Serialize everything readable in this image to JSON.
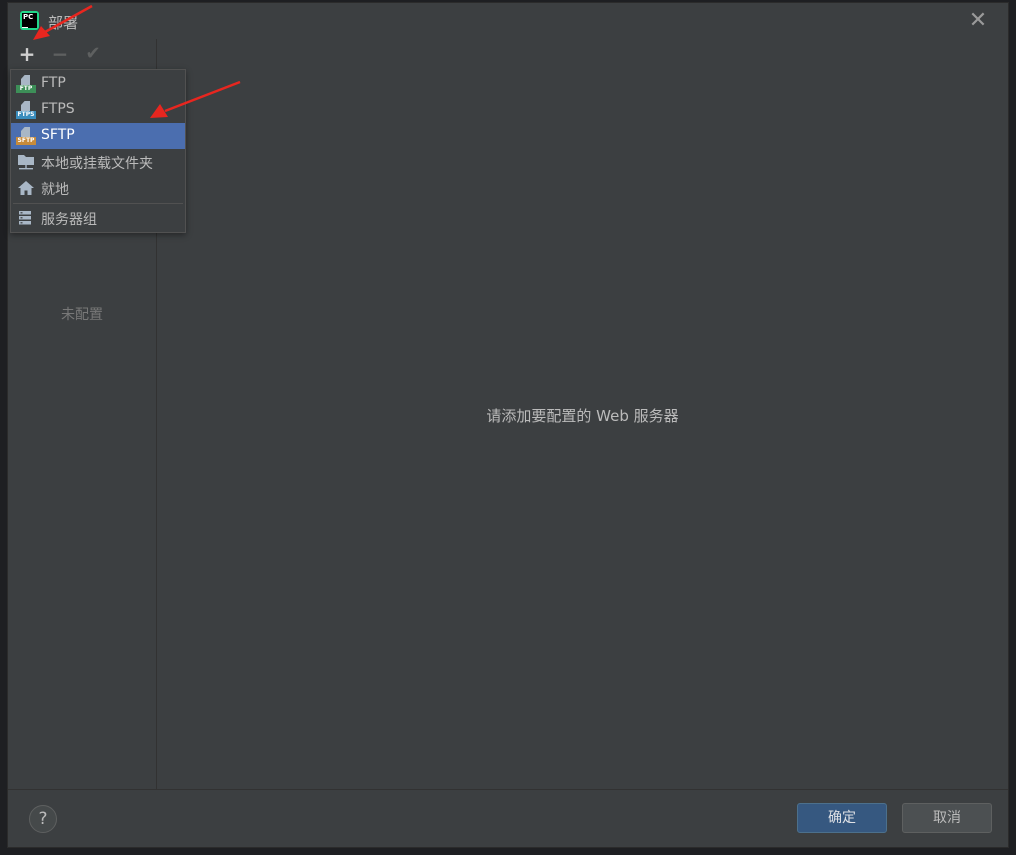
{
  "window": {
    "title": "部署",
    "app_icon_text": "PC"
  },
  "toolbar": {
    "add": "+",
    "remove": "−",
    "apply": "✔"
  },
  "sidebar": {
    "empty_text": "未配置"
  },
  "main": {
    "message": "请添加要配置的 Web 服务器"
  },
  "menu": {
    "items": [
      {
        "label": "FTP",
        "icon": "ftp-icon",
        "badge": "FTP",
        "badge_color": "#3d8f58",
        "selected": false
      },
      {
        "label": "FTPS",
        "icon": "ftps-icon",
        "badge": "FTPS",
        "badge_color": "#3a8dbd",
        "selected": false
      },
      {
        "label": "SFTP",
        "icon": "sftp-icon",
        "badge": "SFTP",
        "badge_color": "#c78b3a",
        "selected": true
      },
      {
        "label": "本地或挂载文件夹",
        "icon": "network-folder-icon",
        "selected": false
      },
      {
        "label": "就地",
        "icon": "home-icon",
        "selected": false
      }
    ],
    "group_item": {
      "label": "服务器组",
      "icon": "server-group-icon"
    }
  },
  "footer": {
    "help": "?",
    "ok_label": "确定",
    "cancel_label": "取消"
  },
  "colors": {
    "accent": "#4b6eaf",
    "ok_button": "#365880",
    "annotation_arrow": "#e8261f"
  }
}
